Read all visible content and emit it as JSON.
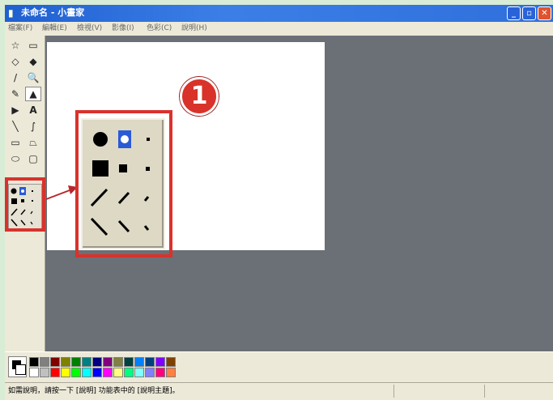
{
  "window": {
    "title": "未命名 - 小畫家",
    "minimize": "_",
    "maximize": "▫",
    "close": "✕"
  },
  "menu": [
    "檔案(F)",
    "編輯(E)",
    "檢視(V)",
    "影像(I)",
    "色彩(C)",
    "說明(H)"
  ],
  "tools": [
    {
      "icon": "free-select-icon",
      "glyph": "☆"
    },
    {
      "icon": "rect-select-icon",
      "glyph": "▭"
    },
    {
      "icon": "eraser-icon",
      "glyph": "◇"
    },
    {
      "icon": "fill-icon",
      "glyph": "◆"
    },
    {
      "icon": "color-picker-icon",
      "glyph": "/"
    },
    {
      "icon": "magnifier-icon",
      "glyph": "🔍"
    },
    {
      "icon": "pencil-icon",
      "glyph": "✎"
    },
    {
      "icon": "brush-icon",
      "glyph": "▲"
    },
    {
      "icon": "airbrush-icon",
      "glyph": "▶"
    },
    {
      "icon": "text-icon",
      "glyph": "A"
    },
    {
      "icon": "line-icon",
      "glyph": "╲"
    },
    {
      "icon": "curve-icon",
      "glyph": "∫"
    },
    {
      "icon": "rectangle-icon",
      "glyph": "▭"
    },
    {
      "icon": "polygon-icon",
      "glyph": "⏢"
    },
    {
      "icon": "ellipse-icon",
      "glyph": "⬭"
    },
    {
      "icon": "rounded-rect-icon",
      "glyph": "▢"
    }
  ],
  "palette": {
    "top": [
      "#000000",
      "#808080",
      "#800000",
      "#808000",
      "#008000",
      "#008080",
      "#000080",
      "#800080",
      "#808040",
      "#004040",
      "#0080ff",
      "#004080",
      "#8000ff",
      "#804000"
    ],
    "bottom": [
      "#ffffff",
      "#c0c0c0",
      "#ff0000",
      "#ffff00",
      "#00ff00",
      "#00ffff",
      "#0000ff",
      "#ff00ff",
      "#ffff80",
      "#00ff80",
      "#80ffff",
      "#8080ff",
      "#ff0080",
      "#ff8040"
    ]
  },
  "status": {
    "text": "如需說明，請按一下 [說明] 功能表中的 [說明主題]。"
  },
  "callout": {
    "number": "1",
    "accent": "#d9322b"
  }
}
